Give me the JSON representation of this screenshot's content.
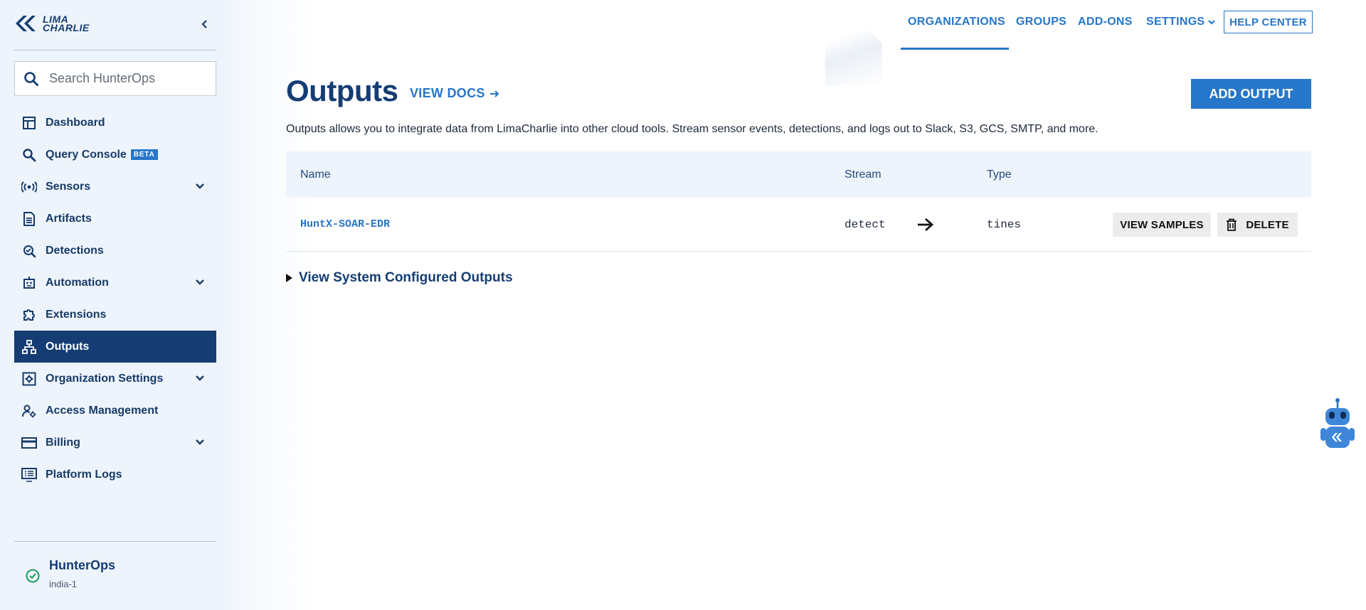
{
  "brand": {
    "line1": "LIMA",
    "line2": "CHARLIE"
  },
  "search": {
    "placeholder": "Search HunterOps"
  },
  "sidebar": {
    "items": [
      {
        "label": "Dashboard"
      },
      {
        "label": "Query Console",
        "badge": "BETA"
      },
      {
        "label": "Sensors"
      },
      {
        "label": "Artifacts"
      },
      {
        "label": "Detections"
      },
      {
        "label": "Automation"
      },
      {
        "label": "Extensions"
      },
      {
        "label": "Outputs"
      },
      {
        "label": "Organization Settings"
      },
      {
        "label": "Access Management"
      },
      {
        "label": "Billing"
      },
      {
        "label": "Platform Logs"
      }
    ],
    "active": "Outputs"
  },
  "org": {
    "name": "HunterOps",
    "region": "india-1"
  },
  "topnav": {
    "organizations": "ORGANIZATIONS",
    "groups": "GROUPS",
    "addons": "ADD-ONS",
    "settings": "SETTINGS",
    "help": "HELP CENTER"
  },
  "page": {
    "title": "Outputs",
    "view_docs": "VIEW DOCS",
    "add_output": "ADD OUTPUT",
    "description": "Outputs allows you to integrate data from LimaCharlie into other cloud tools. Stream sensor events, detections, and logs out to Slack, S3, GCS, SMTP, and more."
  },
  "table": {
    "headers": {
      "name": "Name",
      "stream": "Stream",
      "type": "Type"
    },
    "rows": [
      {
        "name": "HuntX-SOAR-EDR",
        "stream": "detect",
        "type": "tines",
        "view_samples": "VIEW SAMPLES",
        "delete": "DELETE"
      }
    ]
  },
  "system_outputs": {
    "label": "View System Configured Outputs"
  },
  "colors": {
    "primary": "#153d73",
    "accent": "#2676c9",
    "sidebar_bg": "#eef4fb",
    "status_ok": "#1a9b5a"
  }
}
